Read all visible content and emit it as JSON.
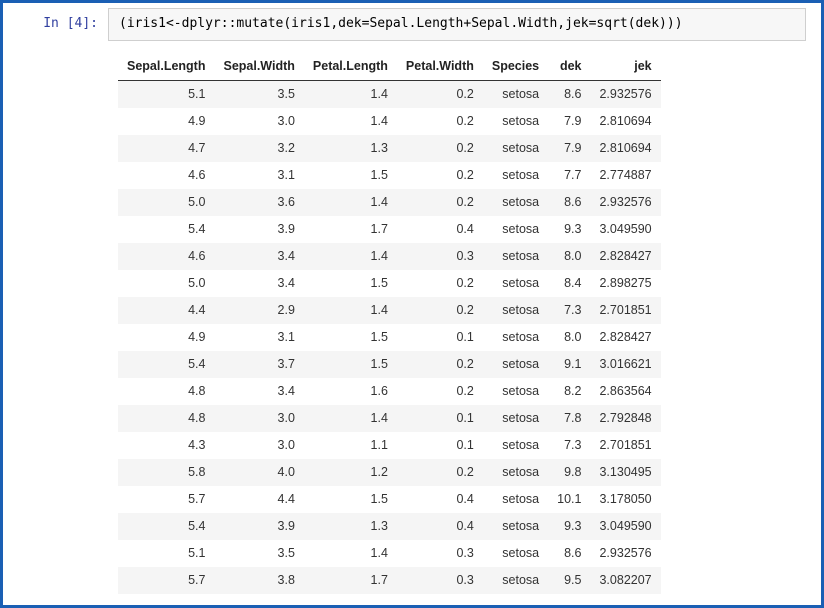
{
  "prompt": {
    "label": "In ",
    "execution_count": "[4]:"
  },
  "code": "(iris1<-dplyr::mutate(iris1,dek=Sepal.Length+Sepal.Width,jek=sqrt(dek)))",
  "table": {
    "headers": [
      "Sepal.Length",
      "Sepal.Width",
      "Petal.Length",
      "Petal.Width",
      "Species",
      "dek",
      "jek"
    ],
    "rows": [
      [
        "5.1",
        "3.5",
        "1.4",
        "0.2",
        "setosa",
        "8.6",
        "2.932576"
      ],
      [
        "4.9",
        "3.0",
        "1.4",
        "0.2",
        "setosa",
        "7.9",
        "2.810694"
      ],
      [
        "4.7",
        "3.2",
        "1.3",
        "0.2",
        "setosa",
        "7.9",
        "2.810694"
      ],
      [
        "4.6",
        "3.1",
        "1.5",
        "0.2",
        "setosa",
        "7.7",
        "2.774887"
      ],
      [
        "5.0",
        "3.6",
        "1.4",
        "0.2",
        "setosa",
        "8.6",
        "2.932576"
      ],
      [
        "5.4",
        "3.9",
        "1.7",
        "0.4",
        "setosa",
        "9.3",
        "3.049590"
      ],
      [
        "4.6",
        "3.4",
        "1.4",
        "0.3",
        "setosa",
        "8.0",
        "2.828427"
      ],
      [
        "5.0",
        "3.4",
        "1.5",
        "0.2",
        "setosa",
        "8.4",
        "2.898275"
      ],
      [
        "4.4",
        "2.9",
        "1.4",
        "0.2",
        "setosa",
        "7.3",
        "2.701851"
      ],
      [
        "4.9",
        "3.1",
        "1.5",
        "0.1",
        "setosa",
        "8.0",
        "2.828427"
      ],
      [
        "5.4",
        "3.7",
        "1.5",
        "0.2",
        "setosa",
        "9.1",
        "3.016621"
      ],
      [
        "4.8",
        "3.4",
        "1.6",
        "0.2",
        "setosa",
        "8.2",
        "2.863564"
      ],
      [
        "4.8",
        "3.0",
        "1.4",
        "0.1",
        "setosa",
        "7.8",
        "2.792848"
      ],
      [
        "4.3",
        "3.0",
        "1.1",
        "0.1",
        "setosa",
        "7.3",
        "2.701851"
      ],
      [
        "5.8",
        "4.0",
        "1.2",
        "0.2",
        "setosa",
        "9.8",
        "3.130495"
      ],
      [
        "5.7",
        "4.4",
        "1.5",
        "0.4",
        "setosa",
        "10.1",
        "3.178050"
      ],
      [
        "5.4",
        "3.9",
        "1.3",
        "0.4",
        "setosa",
        "9.3",
        "3.049590"
      ],
      [
        "5.1",
        "3.5",
        "1.4",
        "0.3",
        "setosa",
        "8.6",
        "2.932576"
      ],
      [
        "5.7",
        "3.8",
        "1.7",
        "0.3",
        "setosa",
        "9.5",
        "3.082207"
      ]
    ]
  }
}
